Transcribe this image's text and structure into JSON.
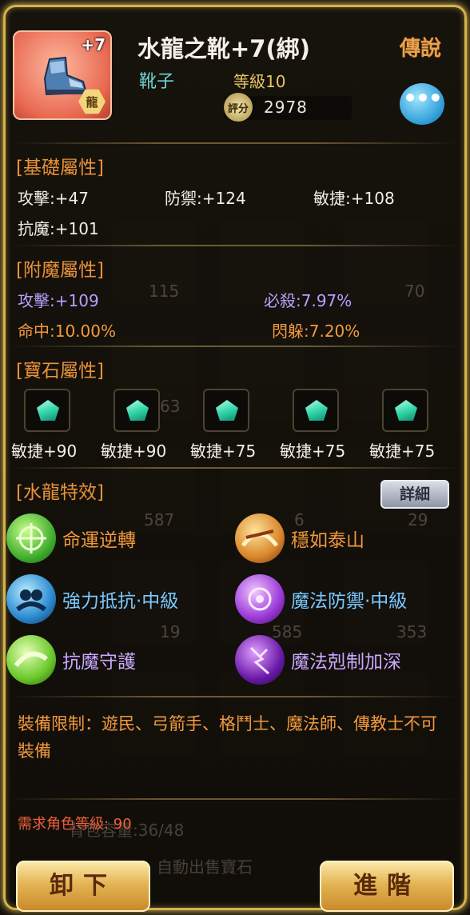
{
  "item": {
    "name": "水龍之靴+7(綁)",
    "plus": "+7",
    "bound_mark": "龍",
    "type": "靴子",
    "level": "等級10",
    "score_icon": "評分",
    "score": "2978",
    "rarity": "傳說"
  },
  "base": {
    "title": "[基礎屬性]",
    "stats": [
      "攻擊:+47",
      "防禦:+124",
      "敏捷:+108",
      "抗魔:+101"
    ]
  },
  "enchant": {
    "title": "[附魔屬性]",
    "stats": [
      "攻擊:+109",
      "必殺:7.97%",
      "命中:10.00%",
      "閃躲:7.20%"
    ]
  },
  "gems": {
    "title": "[寶石屬性]",
    "labels": [
      "敏捷+90",
      "敏捷+90",
      "敏捷+75",
      "敏捷+75",
      "敏捷+75"
    ]
  },
  "effects": {
    "title": "[水龍特效]",
    "detail_button": "詳細",
    "items": [
      "命運逆轉",
      "穩如泰山",
      "強力抵抗·中級",
      "魔法防禦·中級",
      "抗魔守護",
      "魔法剋制加深"
    ]
  },
  "restriction": "裝備限制：遊民、弓箭手、格鬥士、魔法師、傳教士不可裝備",
  "required_level": "需求角色等級: 90",
  "background": {
    "numbers": [
      "115",
      "70",
      "63",
      "587",
      "6",
      "29",
      "19",
      "585",
      "353"
    ],
    "capacity": "背包容量:36/48",
    "auto_sell": "自動出售寶石"
  },
  "buttons": {
    "unequip": "卸下",
    "advance": "進階"
  }
}
